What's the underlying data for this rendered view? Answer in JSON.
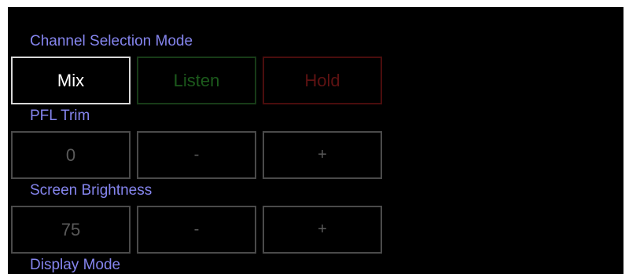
{
  "channel_selection": {
    "title": "Channel Selection Mode",
    "options": [
      "Mix",
      "Listen",
      "Hold"
    ],
    "selected": "Mix",
    "colors": {
      "selected_border": "#d8d8d8",
      "listen": "#1c5a1c",
      "hold": "#5e1212"
    }
  },
  "pfl_trim": {
    "title": "PFL Trim",
    "value": "0",
    "decrement_label": "-",
    "increment_label": "+"
  },
  "screen_brightness": {
    "title": "Screen Brightness",
    "value": "75",
    "decrement_label": "-",
    "increment_label": "+"
  },
  "display_mode": {
    "title": "Display Mode"
  },
  "theme": {
    "background": "#000000",
    "label_color": "#8585ee",
    "inactive_border": "#4a4a4a"
  }
}
